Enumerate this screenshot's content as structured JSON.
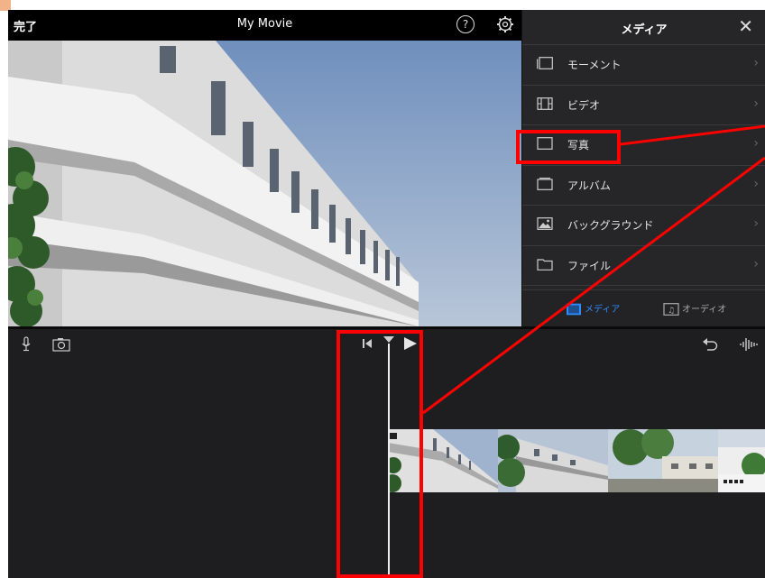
{
  "topbar": {
    "done_label": "完了",
    "title": "My Movie",
    "help_label": "?"
  },
  "media": {
    "title": "メディア",
    "close_label": "✕",
    "items": [
      {
        "label": "モーメント",
        "icon": "moments-icon"
      },
      {
        "label": "ビデオ",
        "icon": "film-icon"
      },
      {
        "label": "写真",
        "icon": "photo-icon"
      },
      {
        "label": "アルバム",
        "icon": "album-icon"
      },
      {
        "label": "バックグラウンド",
        "icon": "background-image-icon"
      },
      {
        "label": "ファイル",
        "icon": "folder-icon"
      }
    ],
    "chevron": "›",
    "tabs": [
      {
        "label": "メディア",
        "icon": "media-icon",
        "active": true
      },
      {
        "label": "オーディオ",
        "icon": "audio-icon",
        "active": false
      }
    ]
  },
  "colors": {
    "accent": "#2f8cff",
    "highlight": "#ff0000",
    "panel": "#262628",
    "timeline": "#1e1e20"
  }
}
